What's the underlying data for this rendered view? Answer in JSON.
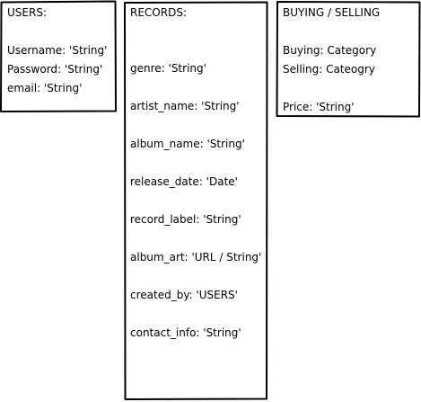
{
  "users": {
    "title": "USERS:",
    "fields": [
      "Username:  'String'",
      "Password: 'String'",
      "email:  'String'"
    ]
  },
  "records": {
    "title": "RECORDS:",
    "fields": [
      "genre: 'String'",
      "artist_name: 'String'",
      "album_name: 'String'",
      "release_date: 'Date'",
      "record_label: 'String'",
      "album_art: 'URL / String'",
      "created_by: 'USERS'",
      "contact_info: 'String'"
    ]
  },
  "buying_selling": {
    "title": "BUYING / SELLING",
    "fields": [
      "Buying: Category",
      "Selling: Cateogry",
      "Price: 'String'"
    ]
  }
}
